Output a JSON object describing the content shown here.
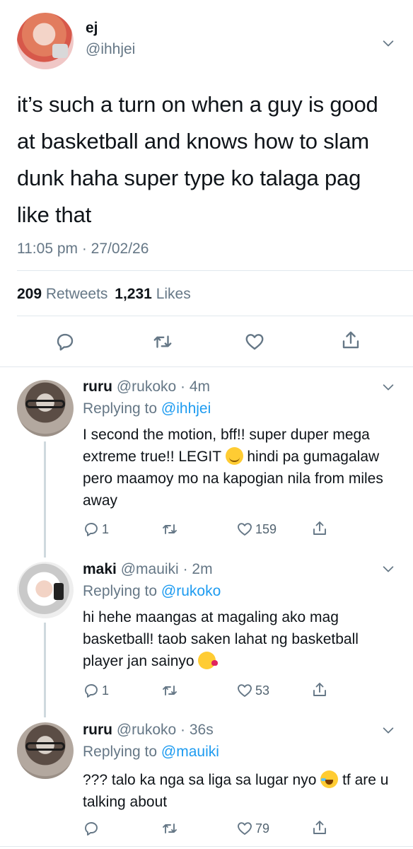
{
  "main_tweet": {
    "name": "ej",
    "handle": "@ihhjei",
    "text": "it’s such a turn on when a guy is good at basketball and knows how to slam dunk haha super type ko talaga pag like that",
    "timestamp": "11:05 pm · 27/02/26",
    "retweets_count": "209",
    "retweets_label": "Retweets",
    "likes_count": "1,231",
    "likes_label": "Likes"
  },
  "replies": [
    {
      "name": "ruru",
      "handle": "@rukoko",
      "time": "4m",
      "replying_label": "Replying to",
      "replying_to": "@ihhjei",
      "text_before_emoji": "I second the motion, bff!! super duper mega extreme true!! LEGIT",
      "emoji": "smiling-face-emoji",
      "text_after_emoji": "hindi pa gumagalaw pero maamoy mo na kapogian nila from miles away",
      "replies_count": "1",
      "likes_count": "159"
    },
    {
      "name": "maki",
      "handle": "@mauiki",
      "time": "2m",
      "replying_label": "Replying to",
      "replying_to": "@rukoko",
      "text_before_emoji": "hi hehe maangas at magaling ako mag basketball! taob saken lahat ng basketball player jan sainyo",
      "emoji": "face-blowing-kiss-emoji",
      "text_after_emoji": "",
      "replies_count": "1",
      "likes_count": "53"
    },
    {
      "name": "ruru",
      "handle": "@rukoko",
      "time": "36s",
      "replying_label": "Replying to",
      "replying_to": "@mauiki",
      "text_before_emoji": "??? talo ka nga sa liga sa lugar nyo",
      "emoji": "face-with-tears-of-joy-emoji",
      "text_after_emoji": "tf are u talking about",
      "replies_count": "",
      "likes_count": "79"
    }
  ],
  "colors": {
    "link": "#1d9bf0",
    "muted": "#657786",
    "divider": "#e1e8ed",
    "text": "#0f1419"
  },
  "icons": [
    "chevron-down-icon",
    "reply-icon",
    "retweet-icon",
    "like-icon",
    "share-icon"
  ]
}
